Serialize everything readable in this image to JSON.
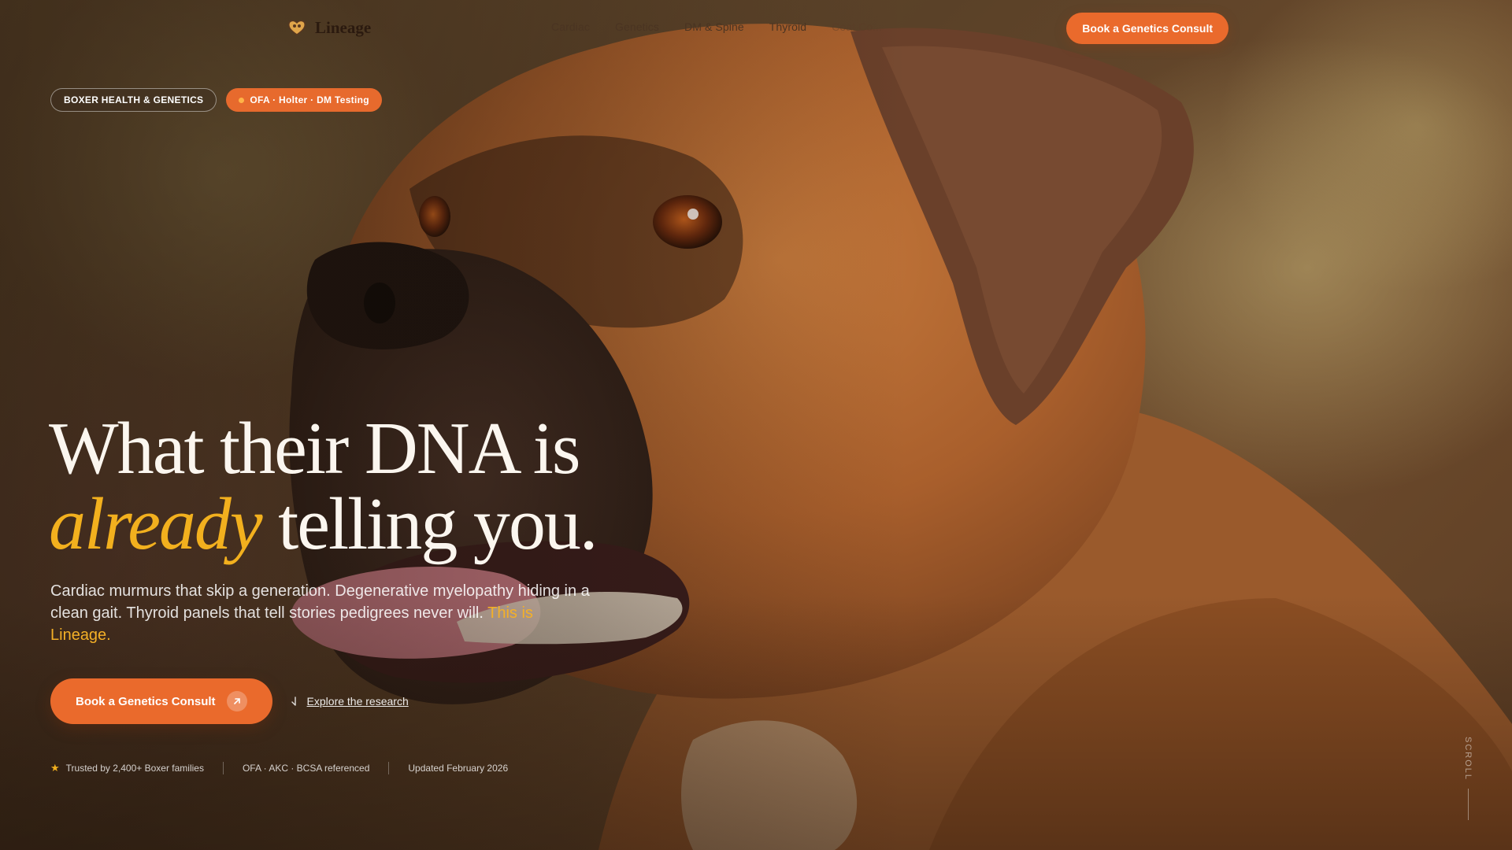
{
  "brand": {
    "name": "Lineage"
  },
  "nav": {
    "items": [
      "Cardiac",
      "Genetics",
      "DM & Spine",
      "Thyroid",
      "Coat Co..."
    ],
    "cta": "Book a Genetics Consult"
  },
  "badges": {
    "category": "BOXER HEALTH & GENETICS",
    "tests": "OFA · Holter · DM Testing"
  },
  "hero": {
    "headline_line1": "What their DNA is",
    "headline_accent": "already",
    "headline_line2_rest": " telling you.",
    "subtext": "Cardiac murmurs that skip a generation. Degenerative myelopathy hiding in a clean gait. Thyroid panels that tell stories pedigrees never will. ",
    "subtext_highlight": "This is Lineage.",
    "cta_primary": "Book a Genetics Consult",
    "cta_secondary": "Explore the research"
  },
  "trust": {
    "families": "Trusted by 2,400+ Boxer families",
    "references": "OFA · AKC · BCSA referenced",
    "updated": "Updated February 2026"
  },
  "scroll": {
    "label": "SCROLL"
  },
  "colors": {
    "accent": "#ea6a2c",
    "highlight": "#f2b01e",
    "headline": "#fbf6ef"
  }
}
